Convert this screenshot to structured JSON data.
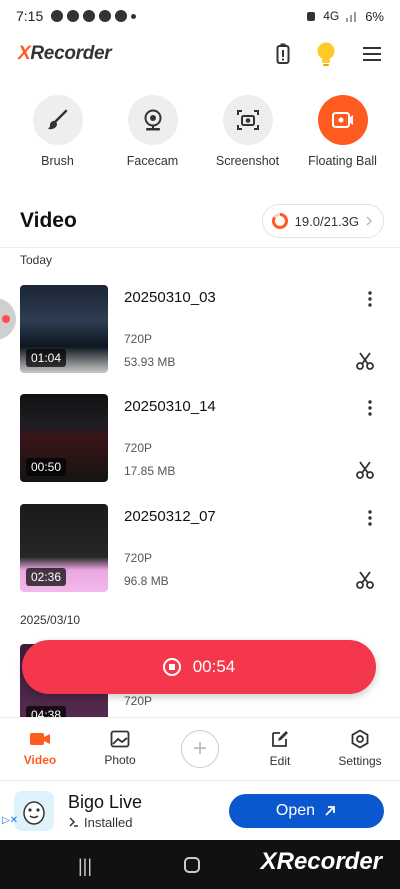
{
  "status_bar": {
    "time": "7:15",
    "network": "4G",
    "battery_percent": "6%"
  },
  "header": {
    "logo_x": "X",
    "logo_rest": "Recorder"
  },
  "tools": [
    {
      "label": "Brush",
      "icon": "brush-icon"
    },
    {
      "label": "Facecam",
      "icon": "webcam-icon"
    },
    {
      "label": "Screenshot",
      "icon": "camera-icon"
    },
    {
      "label": "Floating Ball",
      "icon": "record-icon"
    }
  ],
  "video_section": {
    "title": "Video",
    "storage": "19.0/21.3G"
  },
  "groups": [
    {
      "date": "Today"
    },
    {
      "date": "2025/03/10"
    }
  ],
  "videos": [
    {
      "name": "20250310_03",
      "duration": "01:04",
      "resolution": "720P",
      "size": "53.93 MB"
    },
    {
      "name": "20250310_14",
      "duration": "00:50",
      "resolution": "720P",
      "size": "17.85 MB"
    },
    {
      "name": "20250312_07",
      "duration": "02:36",
      "resolution": "720P",
      "size": "96.8 MB"
    },
    {
      "name": "",
      "duration": "04:38",
      "resolution": "720P",
      "size": ""
    }
  ],
  "recording": {
    "elapsed": "00:54"
  },
  "bottom_nav": [
    {
      "label": "Video",
      "icon": "video-camera-icon",
      "active": true
    },
    {
      "label": "Photo",
      "icon": "photo-icon",
      "active": false
    },
    {
      "label": "",
      "icon": "plus-icon",
      "active": false
    },
    {
      "label": "Edit",
      "icon": "edit-icon",
      "active": false
    },
    {
      "label": "Settings",
      "icon": "settings-icon",
      "active": false
    }
  ],
  "ad": {
    "title": "Bigo Live",
    "subtitle": "Installed",
    "button": "Open"
  },
  "watermark": {
    "x": "X",
    "rest": "Recorder"
  },
  "colors": {
    "accent": "#ff5a1f",
    "record_pill": "#f4374b",
    "ad_button": "#0b57d0"
  }
}
